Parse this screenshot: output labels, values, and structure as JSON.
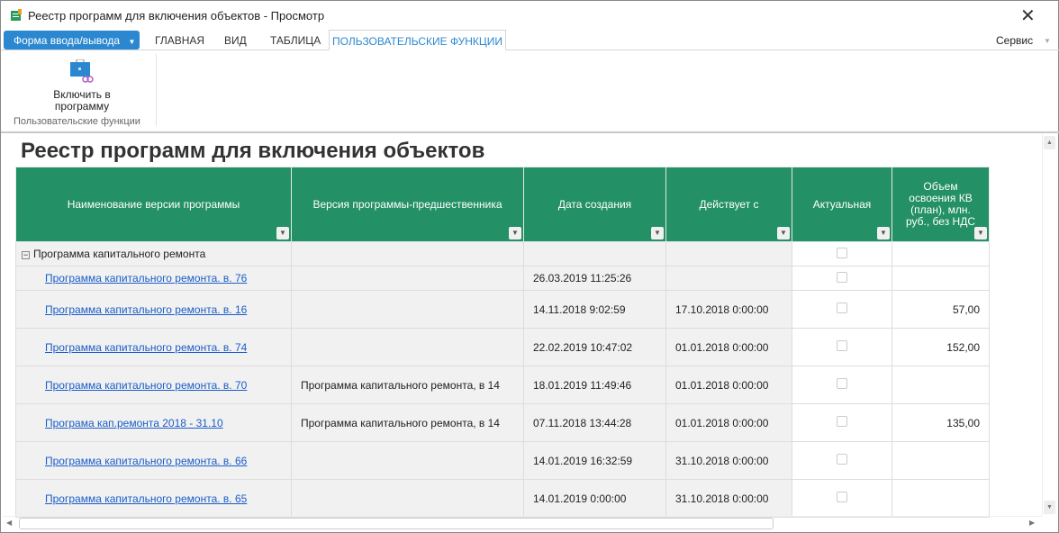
{
  "window": {
    "title": "Реестр программ для включения объектов - Просмотр",
    "close": "✕"
  },
  "menu": {
    "form_button": "Форма ввода/вывода",
    "tabs": [
      "ГЛАВНАЯ",
      "ВИД",
      "ТАБЛИЦА"
    ],
    "active_tab": "ПОЛЬЗОВАТЕЛЬСКИЕ ФУНКЦИИ",
    "service": "Сервис"
  },
  "ribbon": {
    "include_button": "Включить в программу",
    "group_label": "Пользовательские функции"
  },
  "page_title": "Реестр программ для включения объектов",
  "table": {
    "columns": [
      "Наименование версии программы",
      "Версия программы-предшественника",
      "Дата создания",
      "Действует с",
      "Актуальная",
      "Объем освоения КВ (план), млн. руб., без НДС"
    ],
    "group": "Программа капитального ремонта",
    "rows": [
      {
        "name": "Программа капитального ремонта. в. 76",
        "prev": "",
        "created": "26.03.2019 11:25:26",
        "from": "",
        "vol": ""
      },
      {
        "name": "Программа капитального ремонта. в. 16",
        "prev": "",
        "created": "14.11.2018 9:02:59",
        "from": "17.10.2018 0:00:00",
        "vol": "57,00"
      },
      {
        "name": "Программа капитального ремонта. в. 74",
        "prev": "",
        "created": "22.02.2019 10:47:02",
        "from": "01.01.2018 0:00:00",
        "vol": "152,00"
      },
      {
        "name": "Программа капитального ремонта. в. 70",
        "prev": "Программа капитального ремонта, в 14",
        "created": "18.01.2019 11:49:46",
        "from": "01.01.2018 0:00:00",
        "vol": ""
      },
      {
        "name": "Програма кап.ремонта 2018 - 31.10",
        "prev": "Программа капитального ремонта, в 14",
        "created": "07.11.2018 13:44:28",
        "from": "01.01.2018 0:00:00",
        "vol": "135,00"
      },
      {
        "name": "Программа капитального ремонта. в. 66",
        "prev": "",
        "created": "14.01.2019 16:32:59",
        "from": "31.10.2018 0:00:00",
        "vol": ""
      },
      {
        "name": "Программа капитального ремонта. в. 65",
        "prev": "",
        "created": "14.01.2019 0:00:00",
        "from": "31.10.2018 0:00:00",
        "vol": ""
      }
    ]
  },
  "colors": {
    "header": "#239065",
    "accent": "#2b88d0"
  }
}
